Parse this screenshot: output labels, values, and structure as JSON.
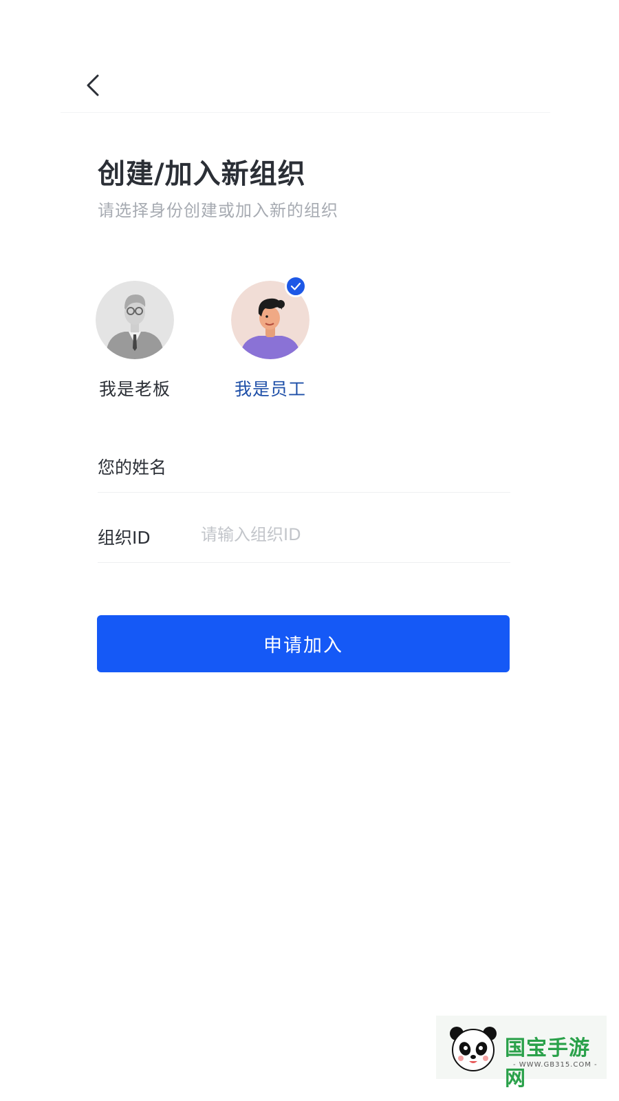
{
  "header": {
    "back_icon": "chevron-left-icon"
  },
  "title": "创建/加入新组织",
  "subtitle": "请选择身份创建或加入新的组织",
  "roles": [
    {
      "label": "我是老板",
      "icon": "boss-avatar",
      "selected": false
    },
    {
      "label": "我是员工",
      "icon": "employee-avatar",
      "selected": true
    }
  ],
  "form": {
    "name_label": "您的姓名",
    "name_value": "",
    "orgid_label": "组织ID",
    "orgid_placeholder": "请输入组织ID",
    "orgid_value": ""
  },
  "submit_label": "申请加入",
  "colors": {
    "primary": "#1559f6",
    "selected_text": "#1e4fa8",
    "subtitle": "#a7abb2",
    "placeholder": "#c2c5ca"
  },
  "watermark": {
    "title": "国宝手游网",
    "url": "- WWW.GB315.COM -"
  }
}
